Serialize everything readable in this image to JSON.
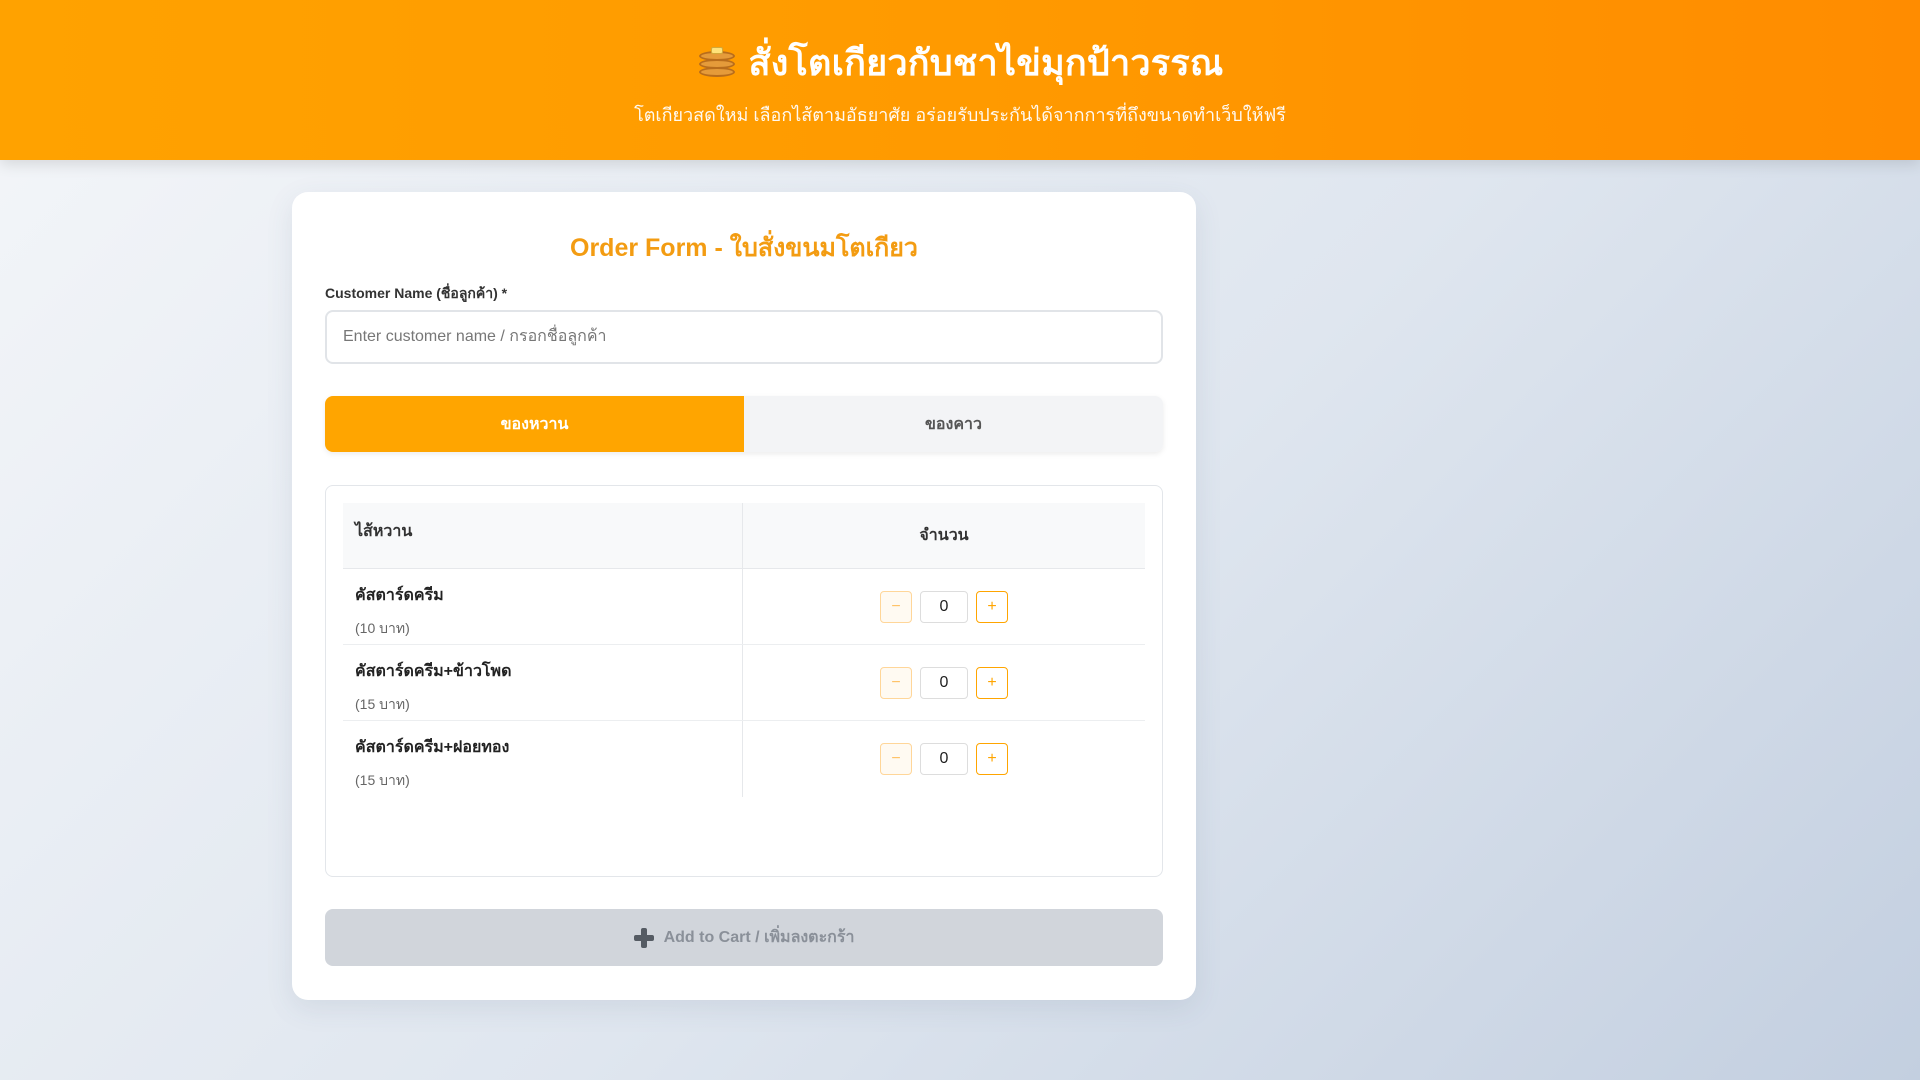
{
  "header": {
    "title": "สั่งโตเกียวกับชาไข่มุกป้าวรรณ",
    "subtitle": "โตเกียวสดใหม่ เลือกไส้ตามอัธยาศัย อร่อยรับประกันได้จากการที่ถึงขนาดทำเว็บให้ฟรี",
    "icon": "pancake-icon"
  },
  "form": {
    "title": "Order Form - ใบสั่งขนมโตเกียว",
    "customer_label": "Customer Name (ชื่อลูกค้า) *",
    "customer_placeholder": "Enter customer name / กรอกชื่อลูกค้า",
    "customer_value": ""
  },
  "tabs": [
    {
      "label": "ของหวาน",
      "active": true
    },
    {
      "label": "ของคาว",
      "active": false
    }
  ],
  "table": {
    "col_name": "ไส้หวาน",
    "col_qty": "จำนวน",
    "rows": [
      {
        "name": "คัสตาร์ดครีม",
        "price": "(10 บาท)",
        "qty": "0"
      },
      {
        "name": "คัสตาร์ดครีม+ข้าวโพด",
        "price": "(15 บาท)",
        "qty": "0"
      },
      {
        "name": "คัสตาร์ดครีม+ฝอยทอง",
        "price": "(15 บาท)",
        "qty": "0"
      }
    ],
    "minus_symbol": "−",
    "plus_symbol": "+"
  },
  "add_button": {
    "label": "Add to Cart / เพิ่มลงตะกร้า",
    "icon": "plus-icon",
    "enabled": false
  },
  "colors": {
    "accent": "#ffa500",
    "header_start": "#ffa200",
    "header_end": "#ff8c00",
    "title": "#f39c12",
    "disabled": "#d1d5db"
  }
}
